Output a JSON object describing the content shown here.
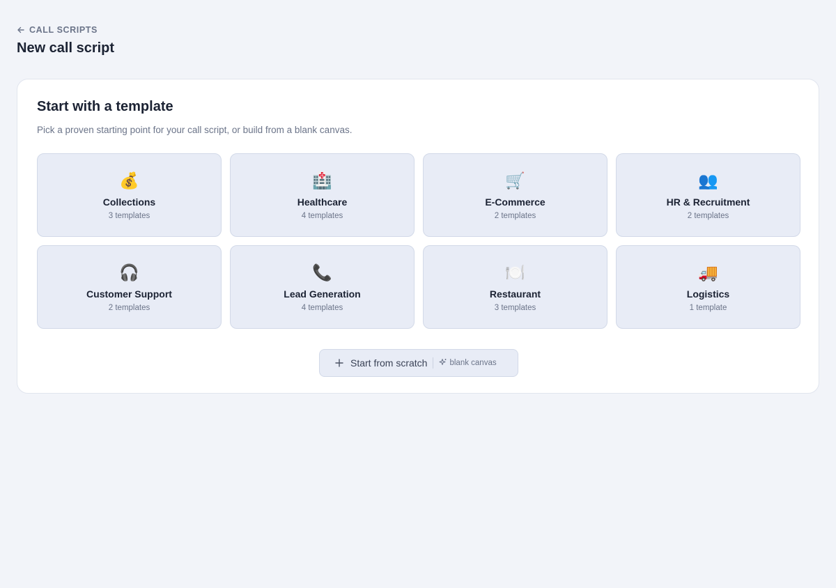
{
  "nav": {
    "back_label": "CALL SCRIPTS",
    "back_icon": "arrow-left-icon"
  },
  "page": {
    "title": "New call script"
  },
  "templates_card": {
    "title": "Start with a template",
    "subtitle": "Pick a proven starting point for your call script, or build from a blank canvas.",
    "categories": [
      {
        "icon": "💰",
        "icon_name": "money-bag-icon",
        "name": "Collections",
        "count": "3 templates"
      },
      {
        "icon": "🏥",
        "icon_name": "hospital-icon",
        "name": "Healthcare",
        "count": "4 templates"
      },
      {
        "icon": "🛒",
        "icon_name": "shopping-cart-icon",
        "name": "E-Commerce",
        "count": "2 templates"
      },
      {
        "icon": "👥",
        "icon_name": "people-icon",
        "name": "HR & Recruitment",
        "count": "2 templates"
      },
      {
        "icon": "🎧",
        "icon_name": "headphones-icon",
        "name": "Customer Support",
        "count": "2 templates"
      },
      {
        "icon": "📞",
        "icon_name": "phone-icon",
        "name": "Lead Generation",
        "count": "4 templates"
      },
      {
        "icon": "🍽️",
        "icon_name": "plate-cutlery-icon",
        "name": "Restaurant",
        "count": "3 templates"
      },
      {
        "icon": "🚚",
        "icon_name": "delivery-truck-icon",
        "name": "Logistics",
        "count": "1 template"
      }
    ],
    "scratch": {
      "label": "Start from scratch",
      "hint": "blank canvas",
      "icon": "plus-icon",
      "hint_icon": "sparkle-icon"
    }
  },
  "colors": {
    "background": "#f2f4f9",
    "card": "#ffffff",
    "tile": "#e8ecf6",
    "tile_border": "#d2d9e8",
    "text_primary": "#1b2233",
    "text_muted": "#6b7489"
  }
}
